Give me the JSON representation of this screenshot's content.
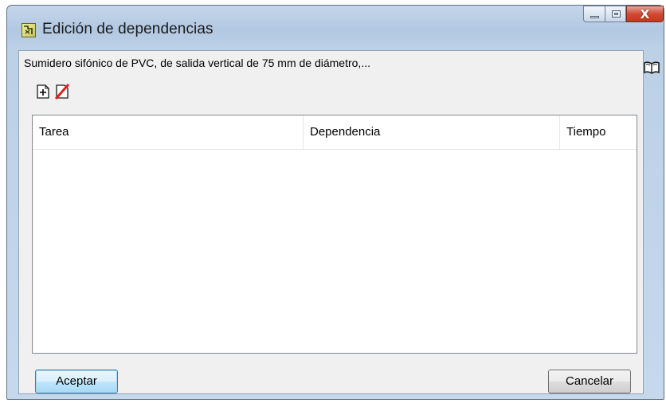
{
  "window": {
    "title": "Edición de dependencias",
    "close_glyph": "X"
  },
  "subtitle": "Sumidero sifónico de PVC, de salida vertical de 75 mm de diámetro,...",
  "toolbar": {
    "add_icon": "add-row-icon",
    "delete_icon": "delete-row-icon"
  },
  "table": {
    "columns": [
      "Tarea",
      "Dependencia",
      "Tiempo"
    ],
    "rows": []
  },
  "buttons": {
    "accept_label": "Aceptar",
    "cancel_label": "Cancelar"
  },
  "side_icon": "book-help-icon",
  "colors": {
    "close_button": "#c0391f",
    "delete_slash": "#e0201a",
    "default_button_border": "#3c7fb1"
  }
}
